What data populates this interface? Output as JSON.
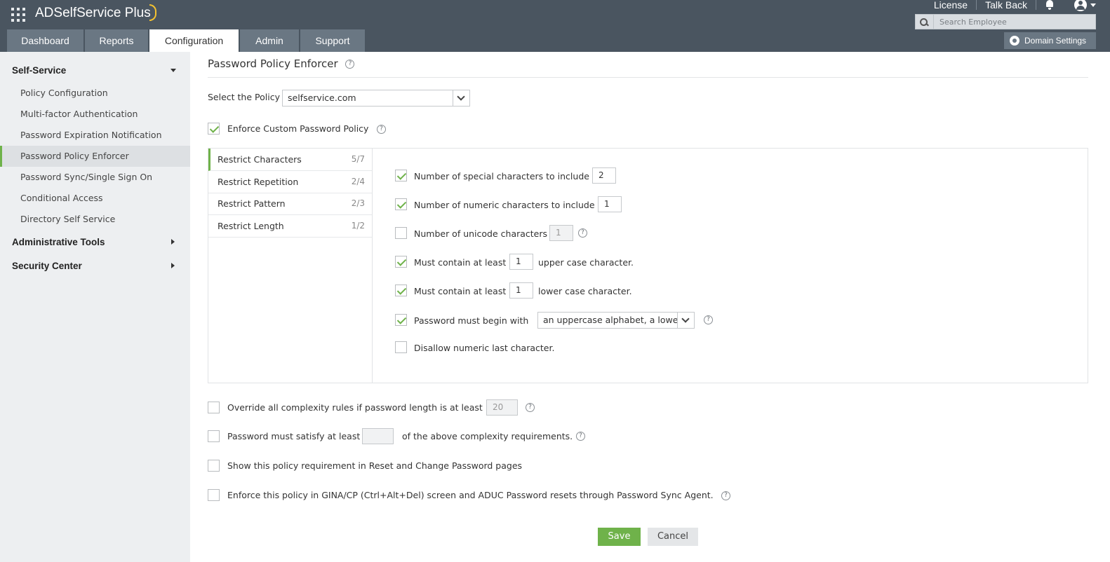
{
  "header": {
    "brand": "ADSelfService Plus",
    "links": {
      "license": "License",
      "talk_back": "Talk Back"
    },
    "search_placeholder": "Search Employee",
    "tabs": [
      "Dashboard",
      "Reports",
      "Configuration",
      "Admin",
      "Support"
    ],
    "active_tab": "Configuration",
    "domain_settings": "Domain Settings"
  },
  "sidebar": {
    "self_service": "Self-Service",
    "items": [
      "Policy Configuration",
      "Multi-factor Authentication",
      "Password Expiration Notification",
      "Password Policy Enforcer",
      "Password Sync/Single Sign On",
      "Conditional Access",
      "Directory Self Service"
    ],
    "active_item": "Password Policy Enforcer",
    "administrative_tools": "Administrative Tools",
    "security_center": "Security Center"
  },
  "main": {
    "title": "Password Policy Enforcer",
    "select_policy_label": "Select the Policy",
    "select_policy_value": "selfservice.com",
    "enforce_custom": {
      "label": "Enforce Custom Password Policy",
      "checked": true
    },
    "subtabs": [
      {
        "label": "Restrict Characters",
        "count": "5/7"
      },
      {
        "label": "Restrict Repetition",
        "count": "2/4"
      },
      {
        "label": "Restrict Pattern",
        "count": "2/3"
      },
      {
        "label": "Restrict Length",
        "count": "1/2"
      }
    ],
    "rules": {
      "special": {
        "label": "Number of special characters to include",
        "value": "2",
        "checked": true
      },
      "numeric": {
        "label": "Number of numeric characters to include",
        "value": "1",
        "checked": true
      },
      "unicode": {
        "label": "Number of unicode characters",
        "value": "1",
        "checked": false
      },
      "upper": {
        "label": "Must contain at least",
        "value": "1",
        "suffix": "upper case character.",
        "checked": true
      },
      "lower": {
        "label": "Must contain at least",
        "value": "1",
        "suffix": "lower case character.",
        "checked": true
      },
      "begin": {
        "label": "Password must begin with",
        "value": "an uppercase alphabet, a lowe",
        "checked": true
      },
      "disallow": {
        "label": "Disallow numeric last character.",
        "checked": false
      }
    },
    "options": {
      "override": {
        "label": "Override all complexity rules if password length is at least",
        "value": "20",
        "checked": false
      },
      "satisfy": {
        "label": "Password must satisfy at least",
        "suffix": "of the above complexity requirements.",
        "value": "",
        "checked": false
      },
      "show": {
        "label": "Show this policy requirement in Reset and Change Password pages",
        "checked": false
      },
      "gina": {
        "label": "Enforce this policy in GINA/CP (Ctrl+Alt+Del) screen and ADUC Password resets through Password Sync Agent.",
        "checked": false
      }
    },
    "buttons": {
      "save": "Save",
      "cancel": "Cancel"
    },
    "help_glyph": "?"
  },
  "colors": {
    "header_bg": "#4a5560",
    "tab_bg": "#6a7783",
    "accent_green": "#6fb24a",
    "sidebar_bg": "#edeff1"
  }
}
